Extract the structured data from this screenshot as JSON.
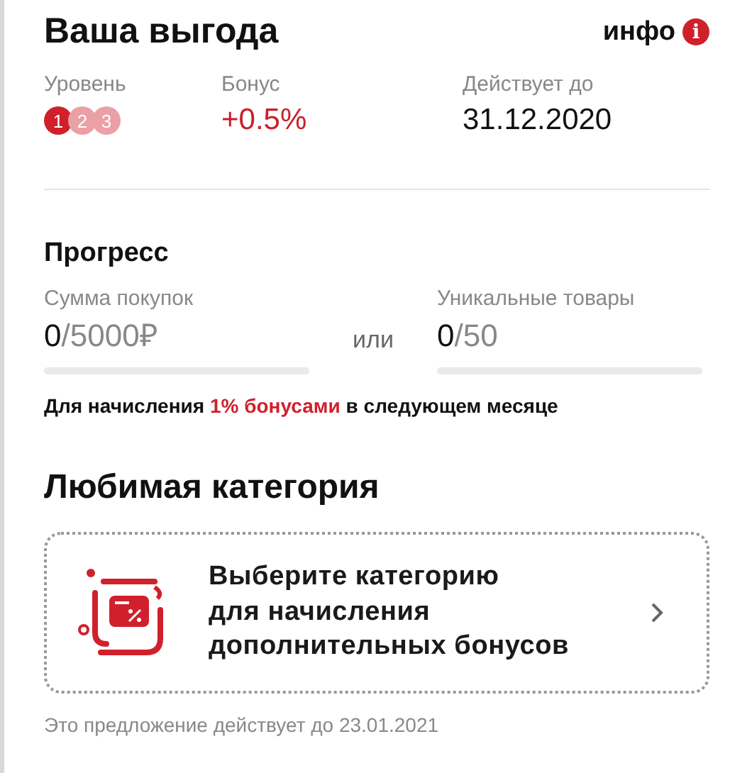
{
  "header": {
    "title": "Ваша выгода",
    "info_link": "инфо",
    "info_icon": "i"
  },
  "level": {
    "label": "Уровень",
    "steps": [
      {
        "label": "1",
        "selected": true
      },
      {
        "label": "2",
        "selected": false
      },
      {
        "label": "3",
        "selected": false
      }
    ]
  },
  "bonus": {
    "label": "Бонус",
    "value": "+0.5%"
  },
  "valid_until": {
    "label": "Действует до",
    "value": "31.12.2020"
  },
  "progress": {
    "title": "Прогресс",
    "separator": "или",
    "metrics": [
      {
        "label": "Сумма покупок",
        "current": "0",
        "target": "/5000₽",
        "level": 0
      },
      {
        "label": "Уникальные товары",
        "current": "0",
        "target": "/50",
        "level": 0
      }
    ],
    "note": "Для начисления **1% бонусами** в следующем месяце"
  },
  "favorite_category": {
    "title": "Любимая категория",
    "card_text": "Выберите категорию\nдля начисления\nдополнительных бонусов",
    "footer": "Это предложение действует до 23.01.2021"
  }
}
